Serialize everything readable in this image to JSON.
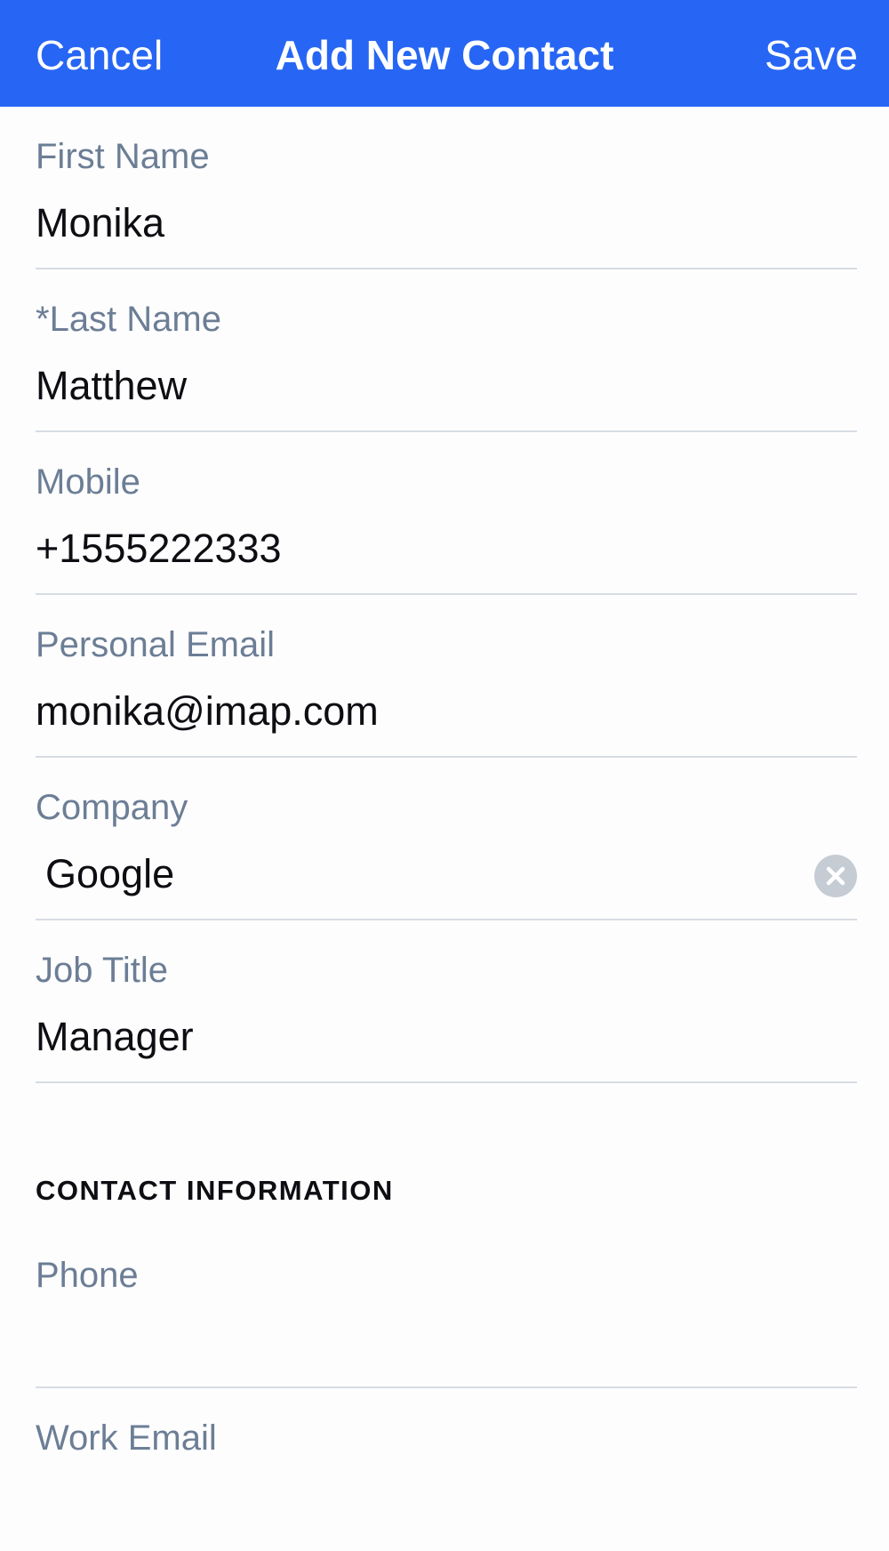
{
  "nav": {
    "cancel_label": "Cancel",
    "title": "Add New Contact",
    "save_label": "Save"
  },
  "fields": [
    {
      "label": "First Name",
      "value": "Monika"
    },
    {
      "label": "*Last Name",
      "value": "Matthew"
    },
    {
      "label": "Mobile",
      "value": "+1555222333"
    },
    {
      "label": "Personal Email",
      "value": "monika@imap.com"
    },
    {
      "label": "Company",
      "value": "Google",
      "clear_icon": "clear-circle-icon"
    },
    {
      "label": "Job Title",
      "value": "Manager"
    }
  ],
  "contact_section": {
    "header": "CONTACT INFORMATION",
    "fields": [
      {
        "label": "Phone",
        "value": ""
      },
      {
        "label": "Work Email",
        "value": ""
      }
    ]
  },
  "colors": {
    "accent": "#2766f4",
    "label": "#6c7e95",
    "divider": "#d7dce2",
    "text": "#0d0d12"
  }
}
